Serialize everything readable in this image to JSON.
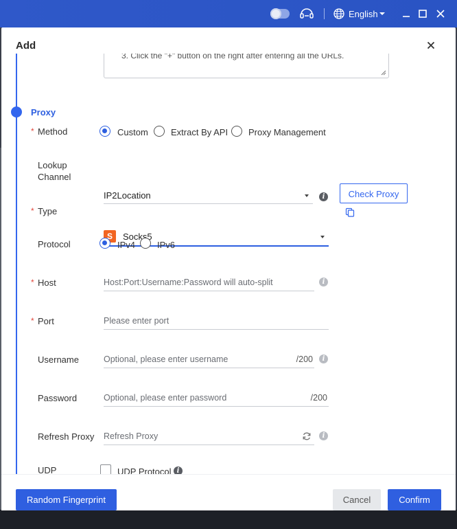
{
  "topbar": {
    "language": "English",
    "icons": [
      "theme-toggle",
      "support-icon",
      "globe-icon",
      "minimize-icon",
      "maximize-icon",
      "close-icon"
    ]
  },
  "modal": {
    "title": "Add",
    "textarea_text": "3. Click the \"+\" button on the right after entering all the URLs.",
    "section_title": "Proxy",
    "method": {
      "label": "Method",
      "options": [
        "Custom",
        "Extract By API",
        "Proxy Management"
      ],
      "selected": "Custom"
    },
    "lookup": {
      "label_line1": "Lookup",
      "label_line2": "Channel",
      "value": "IP2Location",
      "check_button": "Check Proxy"
    },
    "type": {
      "label": "Type",
      "icon_letter": "S",
      "value": "Socks5"
    },
    "protocol": {
      "label": "Protocol",
      "options": [
        "IPv4",
        "IPv6"
      ],
      "selected": "IPv4"
    },
    "host": {
      "label": "Host",
      "placeholder": "Host:Port:Username:Password will auto-split"
    },
    "port": {
      "label": "Port",
      "placeholder": "Please enter port"
    },
    "username": {
      "label": "Username",
      "placeholder": "Optional, please enter username",
      "counter": "/200"
    },
    "password": {
      "label": "Password",
      "placeholder": "Optional, please enter password",
      "counter": "/200"
    },
    "refresh_proxy": {
      "label": "Refresh Proxy",
      "placeholder": "Refresh Proxy"
    },
    "udp": {
      "label": "UDP",
      "checkbox_label": "UDP Protocol"
    },
    "required_mark": "*",
    "info_glyph": "i"
  },
  "footer": {
    "random_fingerprint": "Random Fingerprint",
    "cancel": "Cancel",
    "confirm": "Confirm"
  },
  "colors": {
    "accent": "#2f5fe0",
    "required": "#e2483d",
    "socks_icon": "#f26522"
  }
}
